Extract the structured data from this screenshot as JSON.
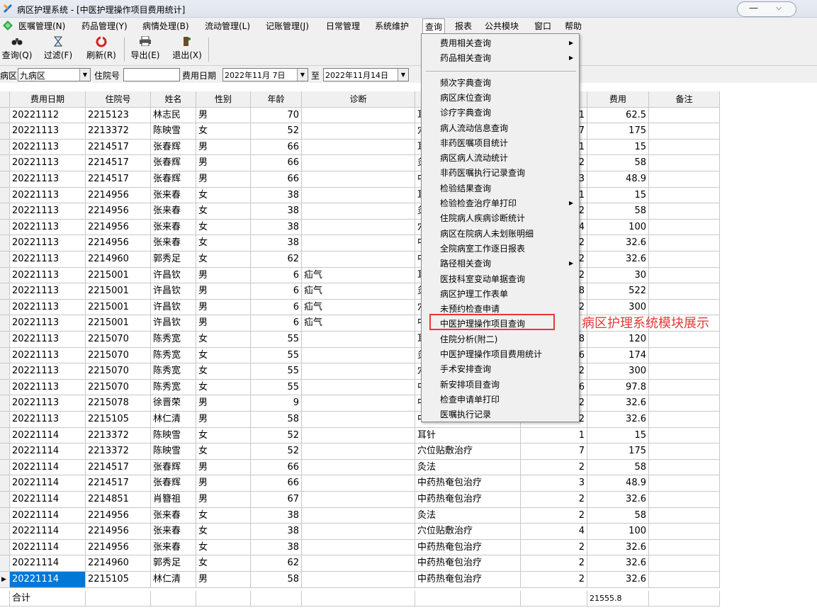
{
  "window": {
    "title": "病区护理系统 - [中医护理操作项目费用统计]"
  },
  "menu": [
    "医嘱管理(N)",
    "药品管理(Y)",
    "病情处理(B)",
    "流动管理(L)",
    "记账管理(J)",
    "日常管理",
    "系统维护",
    "查询",
    "报表",
    "公共模块",
    "窗口",
    "帮助"
  ],
  "toolbar": [
    {
      "icon": "binoculars-icon",
      "label": "查询(Q)"
    },
    {
      "icon": "hourglass-icon",
      "label": "过滤(F)"
    },
    {
      "icon": "refresh-icon",
      "label": "刷新(R)"
    },
    {
      "icon": "printer-icon",
      "label": "导出(E)"
    },
    {
      "icon": "exit-icon",
      "label": "退出(X)"
    }
  ],
  "filter": {
    "ward_label": "病区",
    "ward_value": "九病区",
    "inpatient_label": "住院号",
    "inpatient_value": "",
    "date_label": "费用日期",
    "date_from": "2022年11月 7日",
    "to_label": "至",
    "date_to": "2022年11月14日"
  },
  "columns": [
    "费用日期",
    "住院号",
    "姓名",
    "性别",
    "年龄",
    "诊断",
    "",
    "",
    "费用",
    "备注"
  ],
  "rows": [
    {
      "date": "20221112",
      "id": "2215123",
      "name": "林志民",
      "sex": "男",
      "age": "70",
      "diag": "",
      "item": "耳",
      "qty": "1",
      "fee": "62.5"
    },
    {
      "date": "20221113",
      "id": "2213372",
      "name": "陈映雪",
      "sex": "女",
      "age": "52",
      "diag": "",
      "item": "穴",
      "qty": "7",
      "fee": "175"
    },
    {
      "date": "20221113",
      "id": "2214517",
      "name": "张春辉",
      "sex": "男",
      "age": "66",
      "diag": "",
      "item": "耳",
      "qty": "1",
      "fee": "15"
    },
    {
      "date": "20221113",
      "id": "2214517",
      "name": "张春辉",
      "sex": "男",
      "age": "66",
      "diag": "",
      "item": "灸",
      "qty": "2",
      "fee": "58"
    },
    {
      "date": "20221113",
      "id": "2214517",
      "name": "张春辉",
      "sex": "男",
      "age": "66",
      "diag": "",
      "item": "中",
      "qty": "3",
      "fee": "48.9"
    },
    {
      "date": "20221113",
      "id": "2214956",
      "name": "张来春",
      "sex": "女",
      "age": "38",
      "diag": "",
      "item": "耳",
      "qty": "1",
      "fee": "15"
    },
    {
      "date": "20221113",
      "id": "2214956",
      "name": "张来春",
      "sex": "女",
      "age": "38",
      "diag": "",
      "item": "灸",
      "qty": "2",
      "fee": "58"
    },
    {
      "date": "20221113",
      "id": "2214956",
      "name": "张来春",
      "sex": "女",
      "age": "38",
      "diag": "",
      "item": "穴",
      "qty": "4",
      "fee": "100"
    },
    {
      "date": "20221113",
      "id": "2214956",
      "name": "张来春",
      "sex": "女",
      "age": "38",
      "diag": "",
      "item": "中",
      "qty": "2",
      "fee": "32.6"
    },
    {
      "date": "20221113",
      "id": "2214960",
      "name": "郭秀足",
      "sex": "女",
      "age": "62",
      "diag": "",
      "item": "中",
      "qty": "2",
      "fee": "32.6"
    },
    {
      "date": "20221113",
      "id": "2215001",
      "name": "许昌钦",
      "sex": "男",
      "age": "6",
      "diag": "疝气",
      "item": "耳",
      "qty": "2",
      "fee": "30"
    },
    {
      "date": "20221113",
      "id": "2215001",
      "name": "许昌钦",
      "sex": "男",
      "age": "6",
      "diag": "疝气",
      "item": "灸",
      "qty": "8",
      "fee": "522"
    },
    {
      "date": "20221113",
      "id": "2215001",
      "name": "许昌钦",
      "sex": "男",
      "age": "6",
      "diag": "疝气",
      "item": "穴",
      "qty": "2",
      "fee": "300"
    },
    {
      "date": "20221113",
      "id": "2215001",
      "name": "许昌钦",
      "sex": "男",
      "age": "6",
      "diag": "疝气",
      "item": "中",
      "qty": "",
      "fee": ""
    },
    {
      "date": "20221113",
      "id": "2215070",
      "name": "陈秀宽",
      "sex": "女",
      "age": "55",
      "diag": "",
      "item": "耳",
      "qty": "8",
      "fee": "120"
    },
    {
      "date": "20221113",
      "id": "2215070",
      "name": "陈秀宽",
      "sex": "女",
      "age": "55",
      "diag": "",
      "item": "灸",
      "qty": "6",
      "fee": "174"
    },
    {
      "date": "20221113",
      "id": "2215070",
      "name": "陈秀宽",
      "sex": "女",
      "age": "55",
      "diag": "",
      "item": "穴",
      "qty": "2",
      "fee": "300"
    },
    {
      "date": "20221113",
      "id": "2215070",
      "name": "陈秀宽",
      "sex": "女",
      "age": "55",
      "diag": "",
      "item": "中",
      "qty": "6",
      "fee": "97.8"
    },
    {
      "date": "20221113",
      "id": "2215078",
      "name": "徐晋荣",
      "sex": "男",
      "age": "9",
      "diag": "",
      "item": "中",
      "qty": "2",
      "fee": "32.6"
    },
    {
      "date": "20221113",
      "id": "2215105",
      "name": "林仁清",
      "sex": "男",
      "age": "58",
      "diag": "",
      "item": "中药热奄包治疗",
      "qty": "2",
      "fee": "32.6"
    },
    {
      "date": "20221114",
      "id": "2213372",
      "name": "陈映雪",
      "sex": "女",
      "age": "52",
      "diag": "",
      "item": "耳针",
      "qty": "1",
      "fee": "15"
    },
    {
      "date": "20221114",
      "id": "2213372",
      "name": "陈映雪",
      "sex": "女",
      "age": "52",
      "diag": "",
      "item": "穴位贴敷治疗",
      "qty": "7",
      "fee": "175"
    },
    {
      "date": "20221114",
      "id": "2214517",
      "name": "张春辉",
      "sex": "男",
      "age": "66",
      "diag": "",
      "item": "灸法",
      "qty": "2",
      "fee": "58"
    },
    {
      "date": "20221114",
      "id": "2214517",
      "name": "张春辉",
      "sex": "男",
      "age": "66",
      "diag": "",
      "item": "中药热奄包治疗",
      "qty": "3",
      "fee": "48.9"
    },
    {
      "date": "20221114",
      "id": "2214851",
      "name": "肖簪祖",
      "sex": "男",
      "age": "67",
      "diag": "",
      "item": "中药热奄包治疗",
      "qty": "2",
      "fee": "32.6"
    },
    {
      "date": "20221114",
      "id": "2214956",
      "name": "张来春",
      "sex": "女",
      "age": "38",
      "diag": "",
      "item": "灸法",
      "qty": "2",
      "fee": "58"
    },
    {
      "date": "20221114",
      "id": "2214956",
      "name": "张来春",
      "sex": "女",
      "age": "38",
      "diag": "",
      "item": "穴位贴敷治疗",
      "qty": "4",
      "fee": "100"
    },
    {
      "date": "20221114",
      "id": "2214956",
      "name": "张来春",
      "sex": "女",
      "age": "38",
      "diag": "",
      "item": "中药热奄包治疗",
      "qty": "2",
      "fee": "32.6"
    },
    {
      "date": "20221114",
      "id": "2214960",
      "name": "郭秀足",
      "sex": "女",
      "age": "62",
      "diag": "",
      "item": "中药热奄包治疗",
      "qty": "2",
      "fee": "32.6"
    },
    {
      "date": "20221114",
      "id": "2215105",
      "name": "林仁清",
      "sex": "男",
      "age": "58",
      "diag": "",
      "item": "中药热奄包治疗",
      "qty": "2",
      "fee": "32.6",
      "selected": true
    }
  ],
  "total": {
    "label": "合计",
    "fee": "21555.8"
  },
  "query_menu": [
    {
      "label": "费用相关查询",
      "submenu": true
    },
    {
      "label": "药品相关查询",
      "submenu": true
    },
    {
      "separator": true
    },
    {
      "label": "频次字典查询"
    },
    {
      "label": "病区床位查询"
    },
    {
      "label": "诊疗字典查询"
    },
    {
      "label": "病人流动信息查询"
    },
    {
      "label": "非药医嘱项目统计"
    },
    {
      "label": "病区病人流动统计"
    },
    {
      "label": "非药医嘱执行记录查询"
    },
    {
      "label": "检验结果查询"
    },
    {
      "label": "检验检查治疗单打印",
      "submenu": true
    },
    {
      "label": "住院病人疾病诊断统计"
    },
    {
      "label": "病区在院病人未划账明细"
    },
    {
      "label": "全院病室工作逐日报表"
    },
    {
      "label": "路径相关查询",
      "submenu": true
    },
    {
      "label": "医技科室变动单据查询"
    },
    {
      "label": "病区护理工作表单"
    },
    {
      "label": "未预约检查申请"
    },
    {
      "label": "中医护理操作项目查询",
      "highlighted": true
    },
    {
      "label": "住院分析(附二)"
    },
    {
      "label": "中医护理操作项目费用统计"
    },
    {
      "label": "手术安排查询"
    },
    {
      "label": "新安排项目查询"
    },
    {
      "label": "检查申请单打印"
    },
    {
      "label": "医嘱执行记录"
    }
  ],
  "annotation": "病区护理系统模块展示",
  "colors": {
    "highlight": "#e53935",
    "selection": "#0078d7"
  }
}
